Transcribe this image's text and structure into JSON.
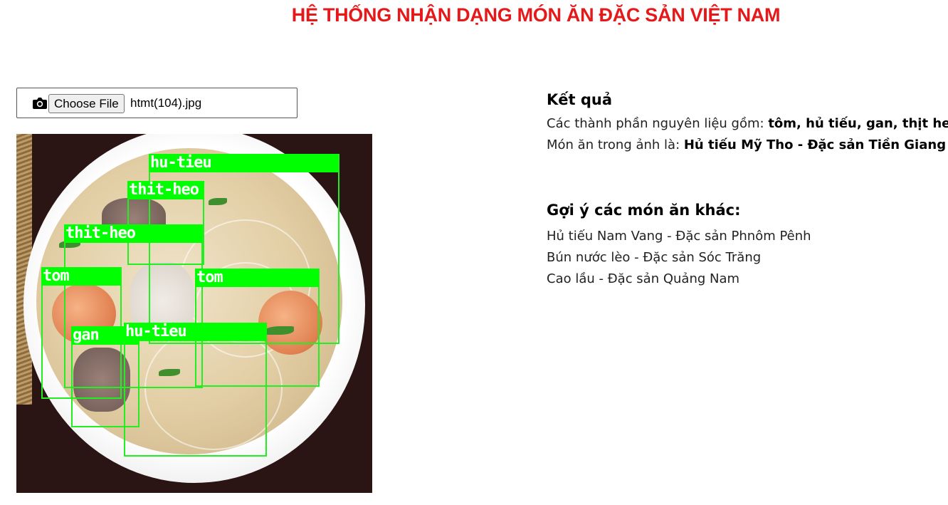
{
  "header": {
    "title": "HỆ THỐNG NHẬN DẠNG MÓN ĂN ĐẶC SẢN VIỆT NAM"
  },
  "upload": {
    "icon": "camera-icon",
    "button_label": "Choose File",
    "file_name": "htmt(104).jpg"
  },
  "detections": [
    {
      "label": "hu-tieu"
    },
    {
      "label": "thit-heo"
    },
    {
      "label": "thit-heo"
    },
    {
      "label": "tom"
    },
    {
      "label": "tom"
    },
    {
      "label": "gan"
    },
    {
      "label": "hu-tieu"
    }
  ],
  "result": {
    "title": "Kết quả",
    "ingredients_prefix": "Các thành phần nguyên liệu gồm: ",
    "ingredients_value": "tôm, hủ tiếu, gan, thịt heo",
    "dish_prefix": "Món ăn trong ảnh là: ",
    "dish_value": "Hủ tiếu Mỹ Tho - Đặc sản Tiền Giang"
  },
  "suggestions": {
    "title": "Gợi ý các món ăn khác:",
    "items": [
      "Hủ tiếu Nam Vang - Đặc sản Phnôm Pênh",
      "Bún nước lèo - Đặc sản Sóc Trăng",
      "Cao lầu - Đặc sản Quảng Nam"
    ]
  },
  "colors": {
    "title": "#e51919",
    "detection": "#00ff00"
  }
}
